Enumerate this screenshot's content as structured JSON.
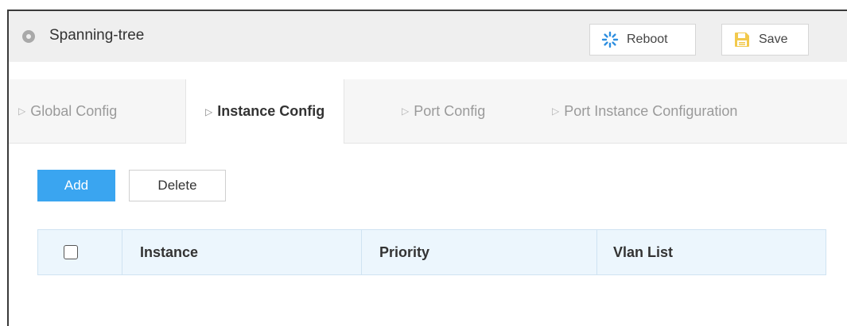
{
  "header": {
    "title": "Spanning-tree",
    "title_icon": "location-pin-icon",
    "reboot_label": "Reboot",
    "reboot_icon": "spinner-icon",
    "save_label": "Save",
    "save_icon": "floppy-disk-icon"
  },
  "tabs": [
    {
      "label": "Global Config",
      "active": false
    },
    {
      "label": "Instance Config",
      "active": true
    },
    {
      "label": "Port Config",
      "active": false
    },
    {
      "label": "Port Instance Configuration",
      "active": false
    }
  ],
  "actions": {
    "add_label": "Add",
    "delete_label": "Delete"
  },
  "table": {
    "columns": [
      "Instance",
      "Priority",
      "Vlan List"
    ],
    "select_all_checked": false,
    "rows": []
  },
  "colors": {
    "accent": "#3aa5f0",
    "header_bg": "#efefef",
    "table_header_bg": "#ecf6fd",
    "save_icon": "#f2c94c",
    "reboot_icon": "#2e8fe0"
  }
}
